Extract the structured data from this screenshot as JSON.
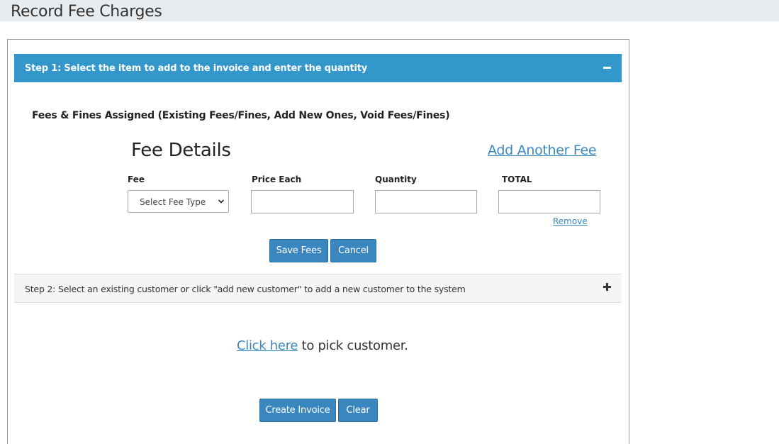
{
  "page": {
    "title": "Record Fee Charges"
  },
  "step1": {
    "label": "Step 1: Select the item to add to the invoice and enter the quantity",
    "collapse_icon": "minus-icon"
  },
  "fees": {
    "heading": "Fees & Fines Assigned (Existing Fees/Fines, Add New Ones, Void Fees/Fines)",
    "details_title": "Fee Details",
    "add_another_label": "Add Another Fee",
    "columns": {
      "fee": "Fee",
      "price_each": "Price Each",
      "quantity": "Quantity",
      "total": "TOTAL"
    },
    "fee_select": {
      "selected": "Select Fee Type",
      "icon": "chevron-down-icon"
    },
    "price_value": "",
    "quantity_value": "",
    "total_value": "",
    "remove_label": "Remove",
    "save_label": "Save Fees",
    "cancel_label": "Cancel"
  },
  "step2": {
    "label": "Step 2: Select an existing customer or click \"add new customer\" to add a new customer to the system",
    "expand_icon": "plus-icon"
  },
  "customer": {
    "link_label": "Click here",
    "suffix": " to pick customer."
  },
  "footer": {
    "create_label": "Create Invoice",
    "clear_label": "Clear"
  },
  "colors": {
    "step1_bar": "#3497cc",
    "button": "#3a86bf",
    "link": "#3a88c2",
    "header_bg": "#e9ecef"
  }
}
